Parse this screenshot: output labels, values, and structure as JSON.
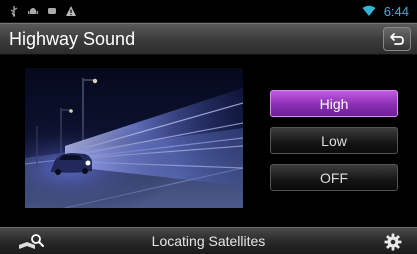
{
  "status_bar": {
    "icons": [
      "usb-icon",
      "android-debug-icon",
      "notification-dot-icon",
      "warning-icon",
      "wifi-icon"
    ],
    "time": "6:44",
    "time_color": "#36b4d6"
  },
  "header": {
    "title": "Highway Sound",
    "back_icon": "back-arrow-icon"
  },
  "options": {
    "items": [
      {
        "label": "High",
        "selected": true
      },
      {
        "label": "Low",
        "selected": false
      },
      {
        "label": "OFF",
        "selected": false
      }
    ],
    "selected_color": "#9b3cc9"
  },
  "bottom_bar": {
    "left_icon": "map-search-icon",
    "status_text": "Locating Satellites",
    "right_icon": "gear-icon"
  }
}
